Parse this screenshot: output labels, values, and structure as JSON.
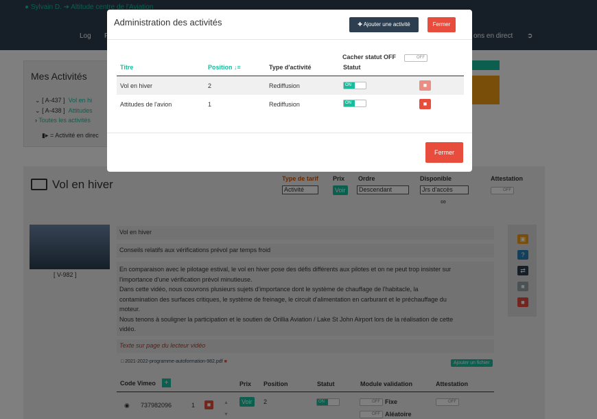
{
  "topbar": {
    "user": "Sylvain D.",
    "org": "Altitude centre de l'Aviation",
    "nav": [
      "Log",
      "F",
      "ons en direct"
    ],
    "logout_icon": "sign-out-icon"
  },
  "mes_activites": {
    "title": "Mes Activités",
    "items": [
      {
        "code": "[ A-437 ]",
        "label": "Vol en hi"
      },
      {
        "code": "[ A-438 ]",
        "label": "Attitudes"
      }
    ],
    "all_link": "Toutes les activités",
    "legend": "= Activité en direc"
  },
  "activity": {
    "title": "Vol en hiver",
    "headers": {
      "type_tarif": "Type de tarif",
      "prix": "Prix",
      "ordre": "Ordre",
      "disponible": "Disponible",
      "attestation": "Attestation"
    },
    "type_tarif_value": "Activité",
    "prix_button": "Voir",
    "ordre_value": "Descendant",
    "disponible_value": "Jrs d'accès",
    "infinity": "∞",
    "attestation_toggle": "OFF",
    "thumb_caption": "[ V-982 ]",
    "name": "Vol en hiver",
    "subtitle": "Conseils relatifs aux vérifications prévol par temps froid",
    "description": [
      "En comparaison avec le pilotage estival, le vol en hiver pose des défis différents aux pilotes et on ne peut trop insister sur",
      "l'importance d'une vérification prévol minutieuse.",
      "Dans cette vidéo, nous couvrons plusieurs sujets d'importance dont le système de chauffage de l'habitacle, la",
      "contamination des surfaces critiques, le système de freinage, le circuit d'alimentation en carburant et le préchauffage du",
      "moteur.",
      "Nous tenons à souligner la participation et le soutien de Orillia Aviation / Lake St John Airport lors de la réalisation de cette",
      "vidéo."
    ],
    "player_text": "Texte sur page du lecteur vidéo",
    "file_name": "2021-2022-programme-autoformation-982.pdf",
    "add_file_button": "Ajouter un fichier",
    "side_icons": [
      "image-icon",
      "help-icon",
      "shuffle-icon",
      "lock-icon",
      "trash-icon"
    ]
  },
  "video_table": {
    "headers": {
      "vimeo": "Code Vimeo",
      "prix": "Prix",
      "position": "Position",
      "statut": "Statut",
      "module": "Module validation",
      "attestation": "Attestation"
    },
    "row": {
      "vimeo_code": "737982096",
      "index": "1",
      "prix_button": "Voir",
      "position": "2",
      "statut": "ON",
      "module_fixe_toggle": "OFF",
      "module_fixe": "Fixe",
      "module_alea_toggle": "OFF",
      "module_alea": "Aléatoire",
      "attestation_toggle": "OFF"
    }
  },
  "modal": {
    "title": "Administration des activités",
    "add_button": "Ajouter une activité",
    "close_top": "Fermer",
    "cacher_label": "Cacher statut OFF",
    "cacher_toggle": "OFF",
    "columns": {
      "titre": "Titre",
      "position": "Position",
      "type": "Type d'activité",
      "statut": "Statut"
    },
    "rows": [
      {
        "titre": "Vol en hiver",
        "position": "2",
        "type": "Rediffusion",
        "statut": "ON"
      },
      {
        "titre": "Attitudes de l'avion",
        "position": "1",
        "type": "Rediffusion",
        "statut": "ON"
      }
    ],
    "close_bottom": "Fermer"
  },
  "colors": {
    "navy": "#2c3e50",
    "teal": "#18bc9c",
    "red": "#e74c3c",
    "orange": "#f39c12"
  }
}
